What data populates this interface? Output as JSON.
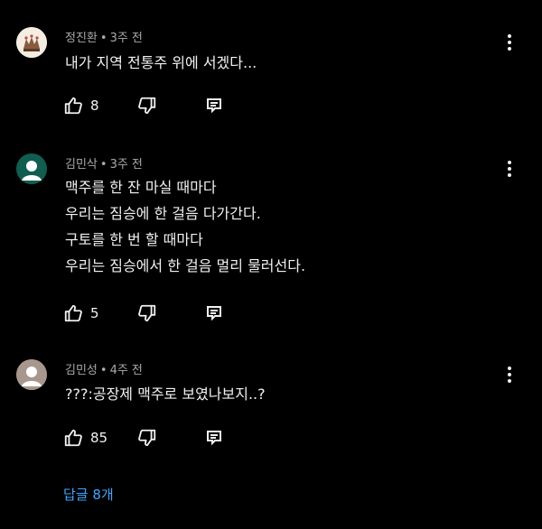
{
  "comments": [
    {
      "author": "정진환",
      "time": "3주 전",
      "lines": [
        "내가 지역 전통주 위에 서겠다..."
      ],
      "likes": "8",
      "avatar": "emblem"
    },
    {
      "author": "김민삭",
      "time": "3주 전",
      "lines": [
        "맥주를 한 잔 마실 때마다",
        "우리는 짐승에 한 걸음 다가간다.",
        "구토를 한 번 할 때마다",
        "우리는 짐승에서 한 걸음 멀리 물러선다."
      ],
      "likes": "5",
      "avatar": "teal-person"
    },
    {
      "author": "김민성",
      "time": "4주 전",
      "lines": [
        "???:공장제 맥주로 보였나보지..?"
      ],
      "likes": "85",
      "avatar": "taupe-person"
    }
  ],
  "separator": "•",
  "replies_label": "답글 8개",
  "icons": {
    "like": "thumbs-up-icon",
    "dislike": "thumbs-down-icon",
    "reply": "reply-icon",
    "more": "more-vert-icon"
  },
  "colors": {
    "background": "#000000",
    "text": "#f1f1f1",
    "meta": "#aaaaaa",
    "link": "#3ea6ff",
    "avatar_teal": "#0f5e50",
    "avatar_taupe": "#a8978c"
  }
}
